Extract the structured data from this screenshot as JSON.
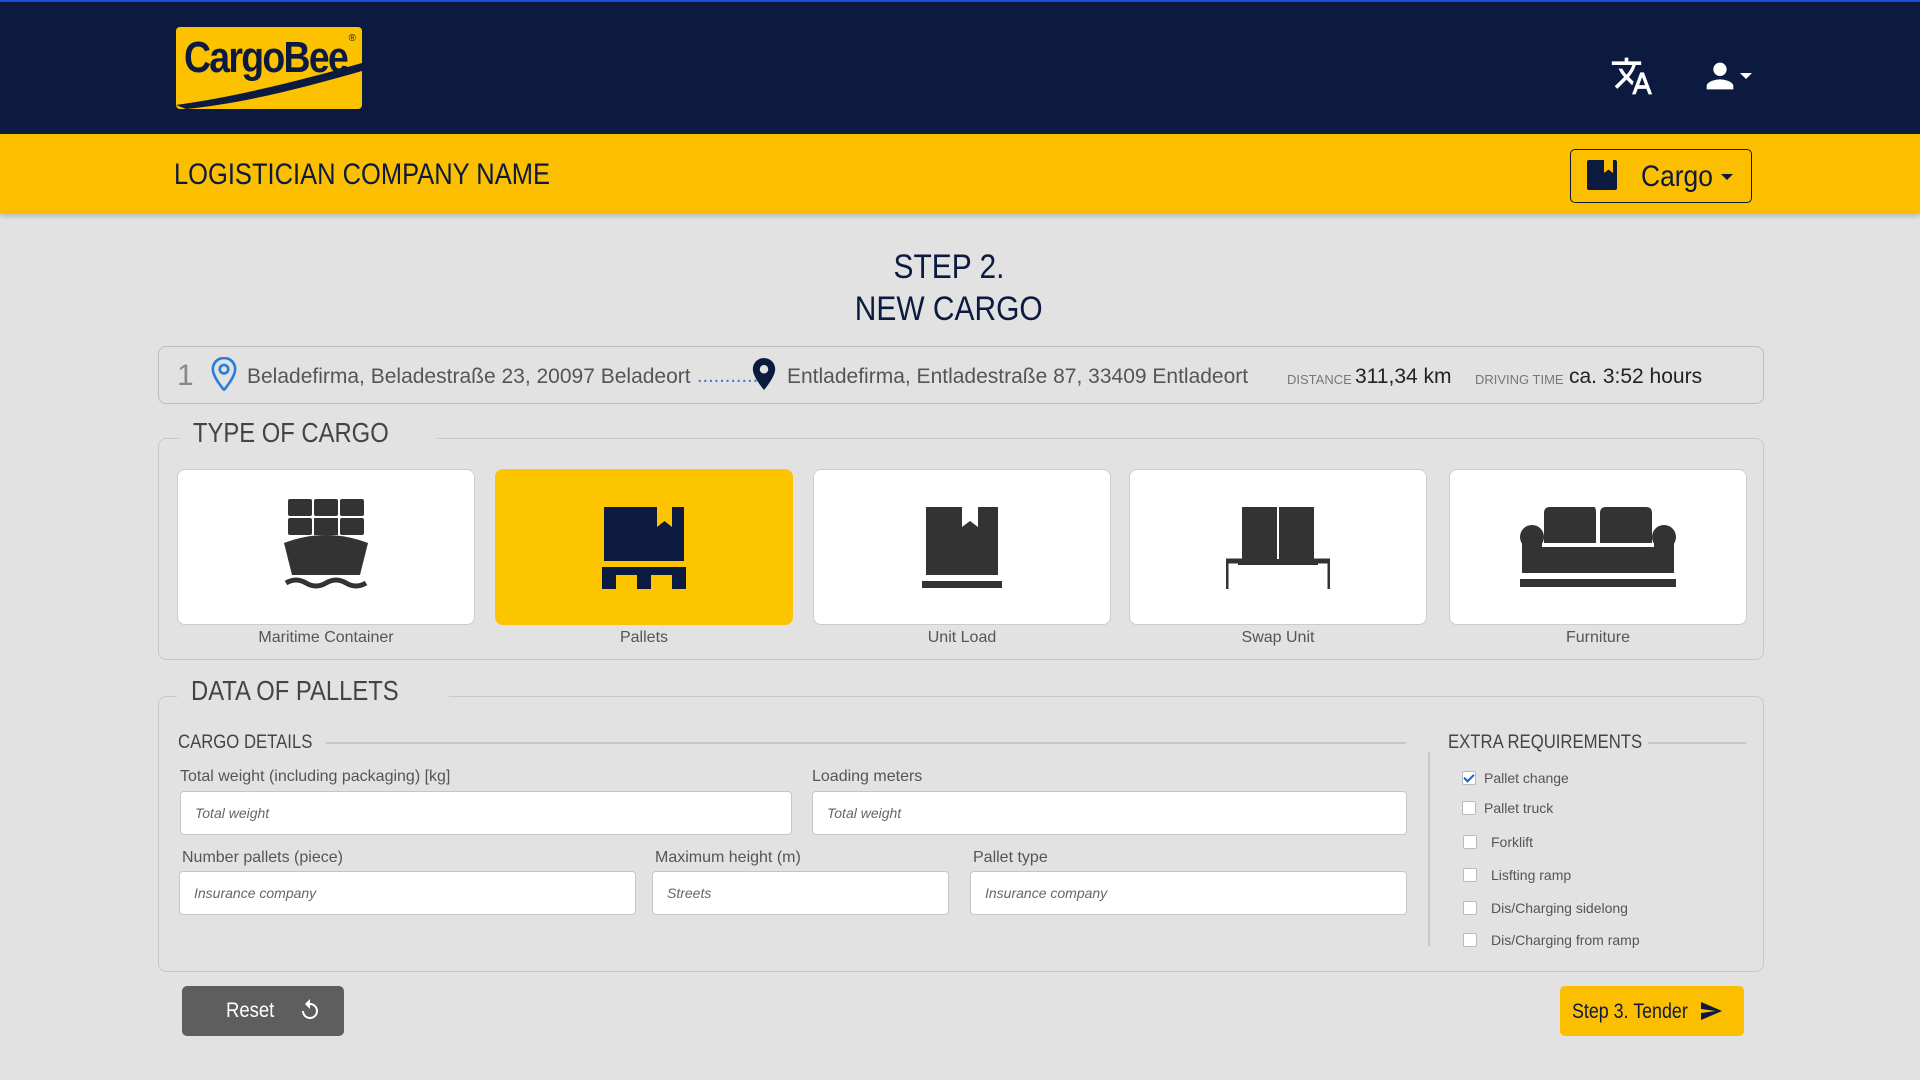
{
  "colors": {
    "navy": "#0b1a3e",
    "yellow": "#fcc200",
    "background": "#e2e2e2"
  },
  "header": {
    "logo_text": "CargoBee",
    "logo_mark": "®",
    "company_name": "LOGISTICIAN COMPANY NAME",
    "cargo_selector": {
      "label": "Cargo",
      "icon": "bookmark-icon"
    },
    "icons": [
      "translate-icon",
      "user-icon"
    ]
  },
  "title": {
    "line1": "STEP 2.",
    "line2": "NEW CARGO"
  },
  "route": {
    "number": "1",
    "from": "Beladefirma, Beladestraße 23, 20097 Beladeort",
    "connector": "...........",
    "to": "Entladefirma, Entladestraße 87, 33409 Entladeort",
    "distance_label": "DISTANCE",
    "distance_value": "311,34 km",
    "time_label": "DRIVING TIME",
    "time_value": "ca. 3:52 hours"
  },
  "type_of_cargo": {
    "legend": "TYPE OF CARGO",
    "selected": "Pallets",
    "options": [
      {
        "label": "Maritime Container",
        "icon": "ship-icon"
      },
      {
        "label": "Pallets",
        "icon": "pallet-icon"
      },
      {
        "label": "Unit Load",
        "icon": "box-icon"
      },
      {
        "label": "Swap Unit",
        "icon": "swap-unit-icon"
      },
      {
        "label": "Furniture",
        "icon": "sofa-icon"
      }
    ]
  },
  "data_of_pallets": {
    "legend": "DATA OF PALLETS",
    "cargo_details": {
      "heading": "CARGO DETAILS",
      "total_weight": {
        "label": "Total weight (including packaging) [kg]",
        "placeholder": "Total weight",
        "value": ""
      },
      "loading_meters": {
        "label": "Loading meters",
        "placeholder": "Total weight",
        "value": ""
      },
      "number_pallets": {
        "label": "Number pallets (piece)",
        "placeholder": "Insurance company",
        "value": ""
      },
      "max_height": {
        "label": "Maximum height (m)",
        "placeholder": "Streets",
        "value": ""
      },
      "pallet_type": {
        "label": "Pallet type",
        "placeholder": "Insurance company",
        "value": ""
      }
    },
    "extra_requirements": {
      "heading": "EXTRA REQUIREMENTS",
      "items": [
        {
          "label": "Pallet change",
          "checked": true
        },
        {
          "label": "Pallet truck",
          "checked": false
        },
        {
          "label": "Forklift",
          "checked": false
        },
        {
          "label": "Lisfting ramp",
          "checked": false
        },
        {
          "label": "Dis/Charging sidelong",
          "checked": false
        },
        {
          "label": "Dis/Charging from ramp",
          "checked": false
        }
      ]
    }
  },
  "footer": {
    "reset_label": "Reset",
    "next_label": "Step 3. Tender"
  }
}
